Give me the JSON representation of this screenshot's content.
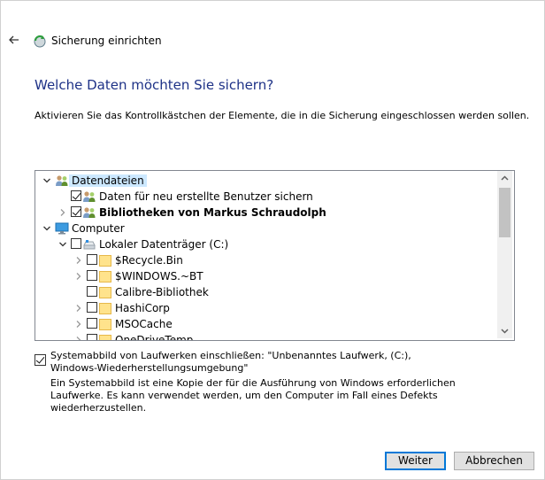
{
  "window": {
    "title": "Sicherung einrichten"
  },
  "page": {
    "heading": "Welche Daten möchten Sie sichern?",
    "instruction": "Aktivieren Sie das Kontrollkästchen der Elemente, die in die Sicherung eingeschlossen werden sollen."
  },
  "tree": {
    "items": [
      {
        "label": "Datendateien",
        "level": 0,
        "expanded": true,
        "checkbox": false,
        "checked": false,
        "icon": "users-icon",
        "selected": true,
        "bold": false
      },
      {
        "label": "Daten für neu erstellte Benutzer sichern",
        "level": 1,
        "expanded": null,
        "checkbox": true,
        "checked": true,
        "icon": "users-icon",
        "selected": false,
        "bold": false
      },
      {
        "label": "Bibliotheken von Markus Schraudolph",
        "level": 1,
        "expanded": false,
        "checkbox": true,
        "checked": true,
        "icon": "users-icon",
        "selected": false,
        "bold": true
      },
      {
        "label": "Computer",
        "level": 0,
        "expanded": true,
        "checkbox": false,
        "checked": false,
        "icon": "computer-icon",
        "selected": false,
        "bold": false
      },
      {
        "label": "Lokaler Datenträger (C:)",
        "level": 1,
        "expanded": true,
        "checkbox": true,
        "checked": false,
        "icon": "drive-icon",
        "selected": false,
        "bold": false
      },
      {
        "label": "$Recycle.Bin",
        "level": 2,
        "expanded": false,
        "checkbox": true,
        "checked": false,
        "icon": "folder-icon",
        "selected": false,
        "bold": false
      },
      {
        "label": "$WINDOWS.~BT",
        "level": 2,
        "expanded": false,
        "checkbox": true,
        "checked": false,
        "icon": "folder-icon",
        "selected": false,
        "bold": false
      },
      {
        "label": "Calibre-Bibliothek",
        "level": 2,
        "expanded": null,
        "checkbox": true,
        "checked": false,
        "icon": "folder-icon",
        "selected": false,
        "bold": false
      },
      {
        "label": "HashiCorp",
        "level": 2,
        "expanded": false,
        "checkbox": true,
        "checked": false,
        "icon": "folder-icon",
        "selected": false,
        "bold": false
      },
      {
        "label": "MSOCache",
        "level": 2,
        "expanded": false,
        "checkbox": true,
        "checked": false,
        "icon": "folder-icon",
        "selected": false,
        "bold": false
      },
      {
        "label": "OneDriveTemp",
        "level": 2,
        "expanded": false,
        "checkbox": true,
        "checked": false,
        "icon": "folder-icon",
        "selected": false,
        "bold": false
      }
    ]
  },
  "system_image": {
    "checked": true,
    "label": "Systemabbild von Laufwerken einschließen: \"Unbenanntes Laufwerk, (C:), Windows-Wiederherstellungsumgebung\"",
    "description": "Ein Systemabbild ist eine Kopie der für die Ausführung von Windows erforderlichen Laufwerke. Es kann verwendet werden, um den Computer im Fall eines Defekts wiederherzustellen."
  },
  "buttons": {
    "next": "Weiter",
    "cancel": "Abbrechen"
  }
}
